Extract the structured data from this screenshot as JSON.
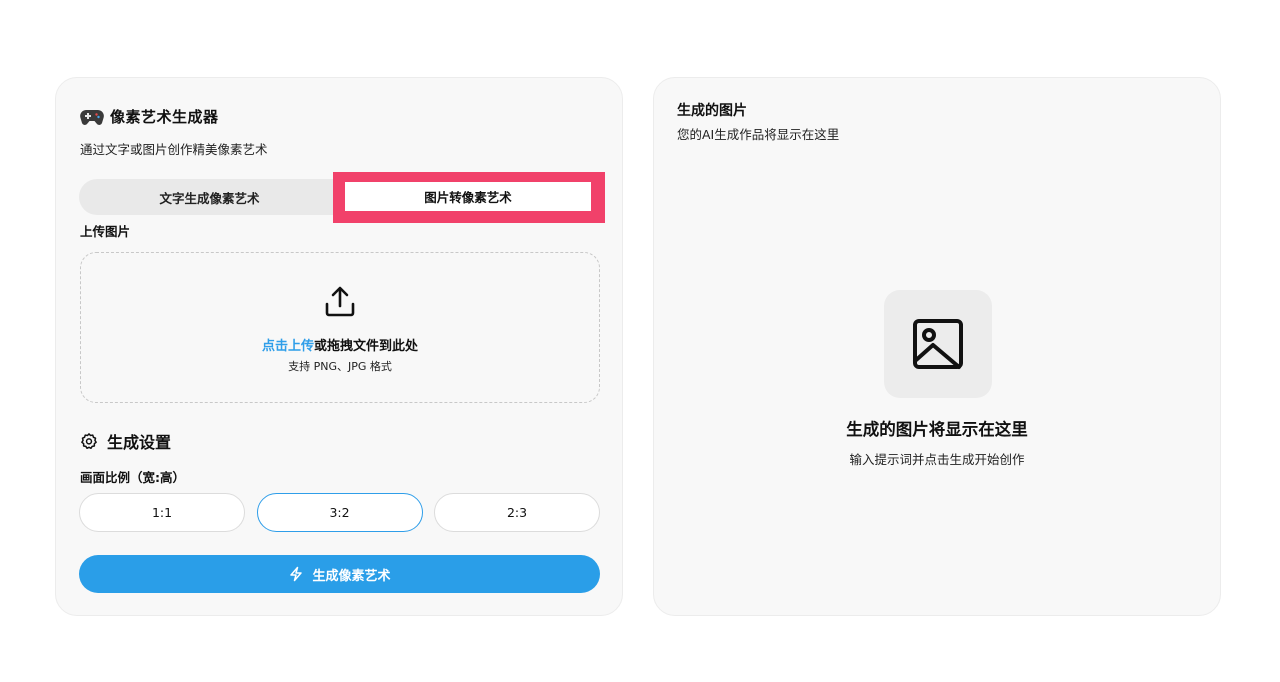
{
  "generator": {
    "title": "像素艺术生成器",
    "subtitle": "通过文字或图片创作精美像素艺术",
    "icon": "gamepad-icon"
  },
  "mode_tabs": [
    {
      "label": "文字生成像素艺术",
      "active": false
    },
    {
      "label": "图片转像素艺术",
      "active": true
    }
  ],
  "highlight_color": "#f1416a",
  "upload": {
    "label": "上传图片",
    "link_text": "点击上传",
    "drop_text": "或拖拽文件到此处",
    "hint": "支持 PNG、JPG 格式",
    "icon": "upload-icon"
  },
  "settings": {
    "title": "生成设置",
    "icon": "gear-icon",
    "ratio_label": "画面比例（宽:高）",
    "ratios": [
      {
        "label": "1:1",
        "selected": false
      },
      {
        "label": "3:2",
        "selected": true
      },
      {
        "label": "2:3",
        "selected": false
      }
    ]
  },
  "generate_button": {
    "label": "生成像素艺术",
    "icon": "bolt-icon",
    "color": "#2a9ee8"
  },
  "output": {
    "title": "生成的图片",
    "subtitle": "您的AI生成作品将显示在这里",
    "placeholder_title": "生成的图片将显示在这里",
    "placeholder_hint": "输入提示词并点击生成开始创作",
    "icon": "image-icon"
  },
  "accent_color": "#2f9ee9"
}
